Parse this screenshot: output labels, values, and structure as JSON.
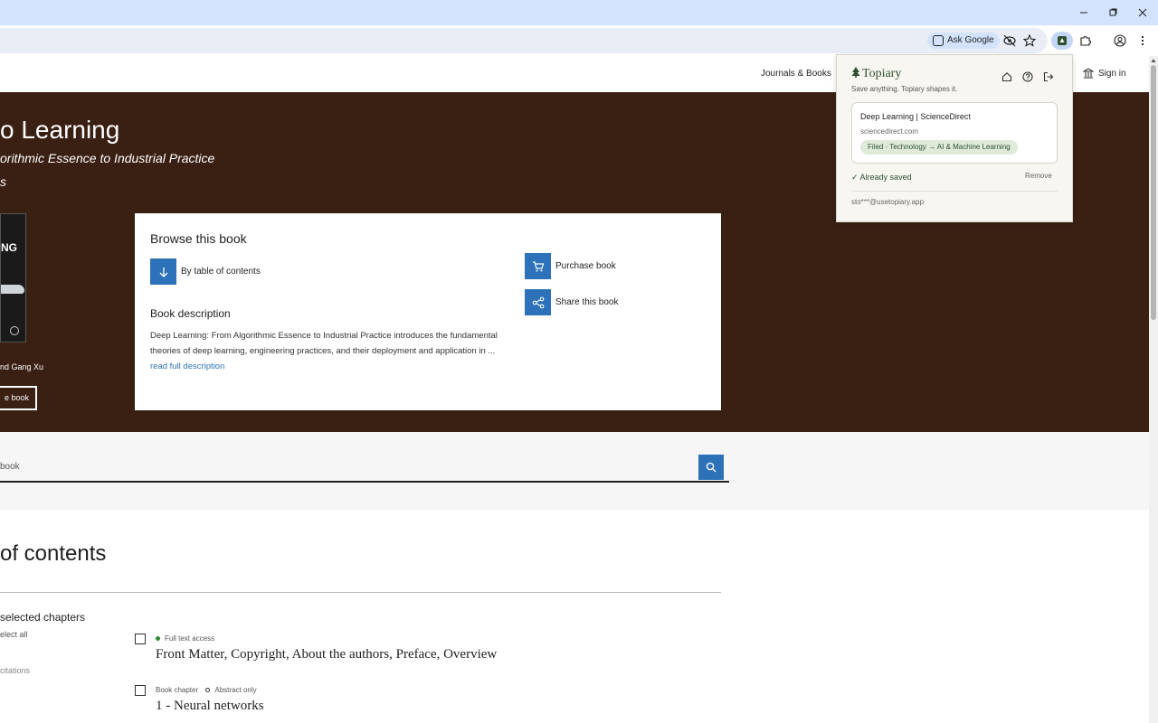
{
  "browser": {
    "ask_google": "Ask Google",
    "icons": [
      "minimize-icon",
      "maximize-icon",
      "close-icon",
      "eye-off-icon",
      "star-icon",
      "topiary-extension-icon",
      "extensions-puzzle-icon",
      "profile-icon",
      "more-vert-icon"
    ]
  },
  "nav": {
    "journals_books": "Journals & Books",
    "sign_in": "Sign in"
  },
  "hero": {
    "title": "o Learning",
    "subtitle": "orithmic Essence to Industrial Practice",
    "subtitle2": "s",
    "cover_text": "NG",
    "authors": "nd Gang Xu",
    "button": "e book"
  },
  "browse": {
    "heading": "Browse this book",
    "toc_link": "By table of contents",
    "purchase": "Purchase book",
    "share": "Share this book",
    "desc_heading": "Book description",
    "desc_text": "Deep Learning: From Algorithmic Essence to Industrial Practice introduces the fundamental theories of deep learning, engineering practices, and their deployment and application in ... ",
    "read_more": "read full description"
  },
  "search": {
    "placeholder": "book"
  },
  "toc": {
    "title": "of contents",
    "selected_chapters": "selected chapters",
    "select_all": "elect all",
    "citations": "citations",
    "chapters": [
      {
        "meta_left": "",
        "meta_right": "Full text access",
        "title": "Front Matter, Copyright, About the authors, Preface, Overview"
      },
      {
        "meta_left": "Book chapter",
        "meta_right": "Abstract only",
        "title": "1 - Neural networks"
      }
    ]
  },
  "popup": {
    "brand": "Topiary",
    "tagline": "Save anything. Topiary shapes it.",
    "card_title": "Deep Learning | ScienceDirect",
    "card_domain": "sciencedirect.com",
    "card_pill": "Filed · Technology → AI & Machine Learning",
    "already_saved": "✓ Already saved",
    "remove": "Remove",
    "email": "sto***@usetopiary.app"
  },
  "colors": {
    "hero_bg": "#3a1f13",
    "accent_blue": "#2d72b8",
    "chrome_bg": "#d3e3fd",
    "popup_green": "#2e5030"
  }
}
